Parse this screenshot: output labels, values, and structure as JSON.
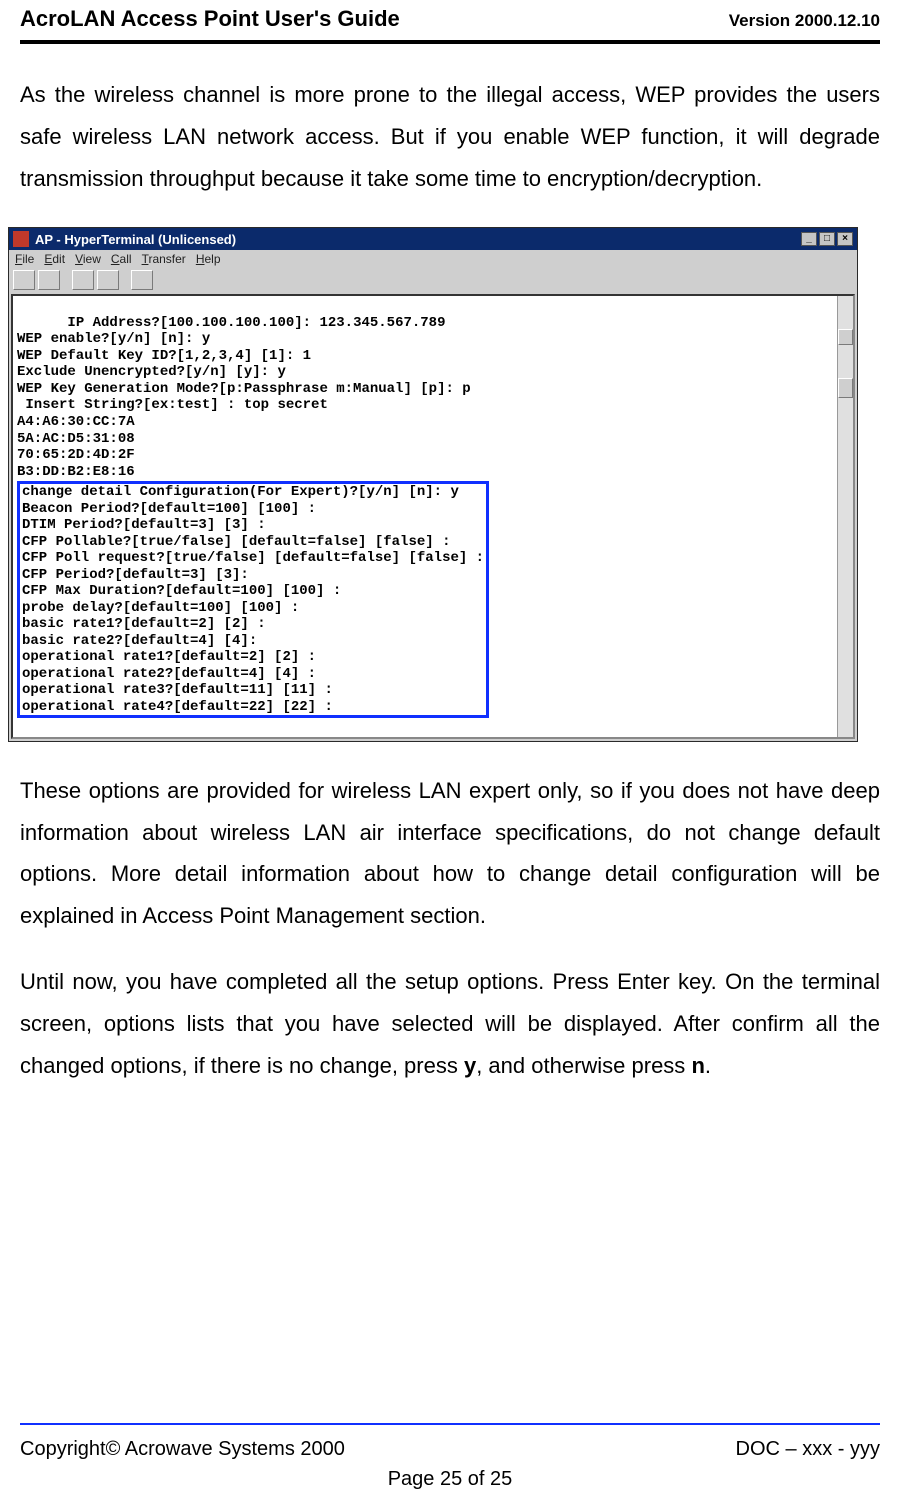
{
  "header": {
    "title": "AcroLAN Access Point User's Guide",
    "version": "Version 2000.12.10"
  },
  "paragraphs": {
    "p1": "As the wireless channel is more prone to the illegal access, WEP provides the users safe wireless LAN network access. But if you enable WEP function, it will degrade transmission throughput because it take some time to encryption/decryption.",
    "p2": "These options are provided for wireless LAN expert only, so if you does not have deep information about wireless LAN air interface specifications, do not change default options. More detail information about how to change detail configuration will be explained in Access Point Management section.",
    "p3_pre": "Until now, you have completed all the setup options. Press Enter key. On the terminal screen, options lists that you have selected will be displayed. After confirm all the changed options, if there is no change, press ",
    "p3_y": "y",
    "p3_mid": ", and otherwise press ",
    "p3_n": "n",
    "p3_end": "."
  },
  "window": {
    "title": "AP - HyperTerminal (Unlicensed)",
    "menus": {
      "file": "File",
      "edit": "Edit",
      "view": "View",
      "call": "Call",
      "transfer": "Transfer",
      "help": "Help"
    },
    "winbtns": {
      "min": "_",
      "max": "□",
      "close": "×"
    },
    "terminal_top": "IP Address?[100.100.100.100]: 123.345.567.789\nWEP enable?[y/n] [n]: y\nWEP Default Key ID?[1,2,3,4] [1]: 1\nExclude Unencrypted?[y/n] [y]: y\nWEP Key Generation Mode?[p:Passphrase m:Manual] [p]: p\n Insert String?[ex:test] : top secret\nA4:A6:30:CC:7A\n5A:AC:D5:31:08\n70:65:2D:4D:2F\nB3:DD:B2:E8:16",
    "terminal_box": "change detail Configuration(For Expert)?[y/n] [n]: y\nBeacon Period?[default=100] [100] :\nDTIM Period?[default=3] [3] :\nCFP Pollable?[true/false] [default=false] [false] :\nCFP Poll request?[true/false] [default=false] [false] :\nCFP Period?[default=3] [3]:\nCFP Max Duration?[default=100] [100] :\nprobe delay?[default=100] [100] :\nbasic rate1?[default=2] [2] :\nbasic rate2?[default=4] [4]:\noperational rate1?[default=2] [2] :\noperational rate2?[default=4] [4] :\noperational rate3?[default=11] [11] :\noperational rate4?[default=22] [22] :"
  },
  "footer": {
    "copyright": "Copyright© Acrowave Systems 2000",
    "doc": "DOC – xxx - yyy",
    "page": "Page 25 of 25"
  }
}
